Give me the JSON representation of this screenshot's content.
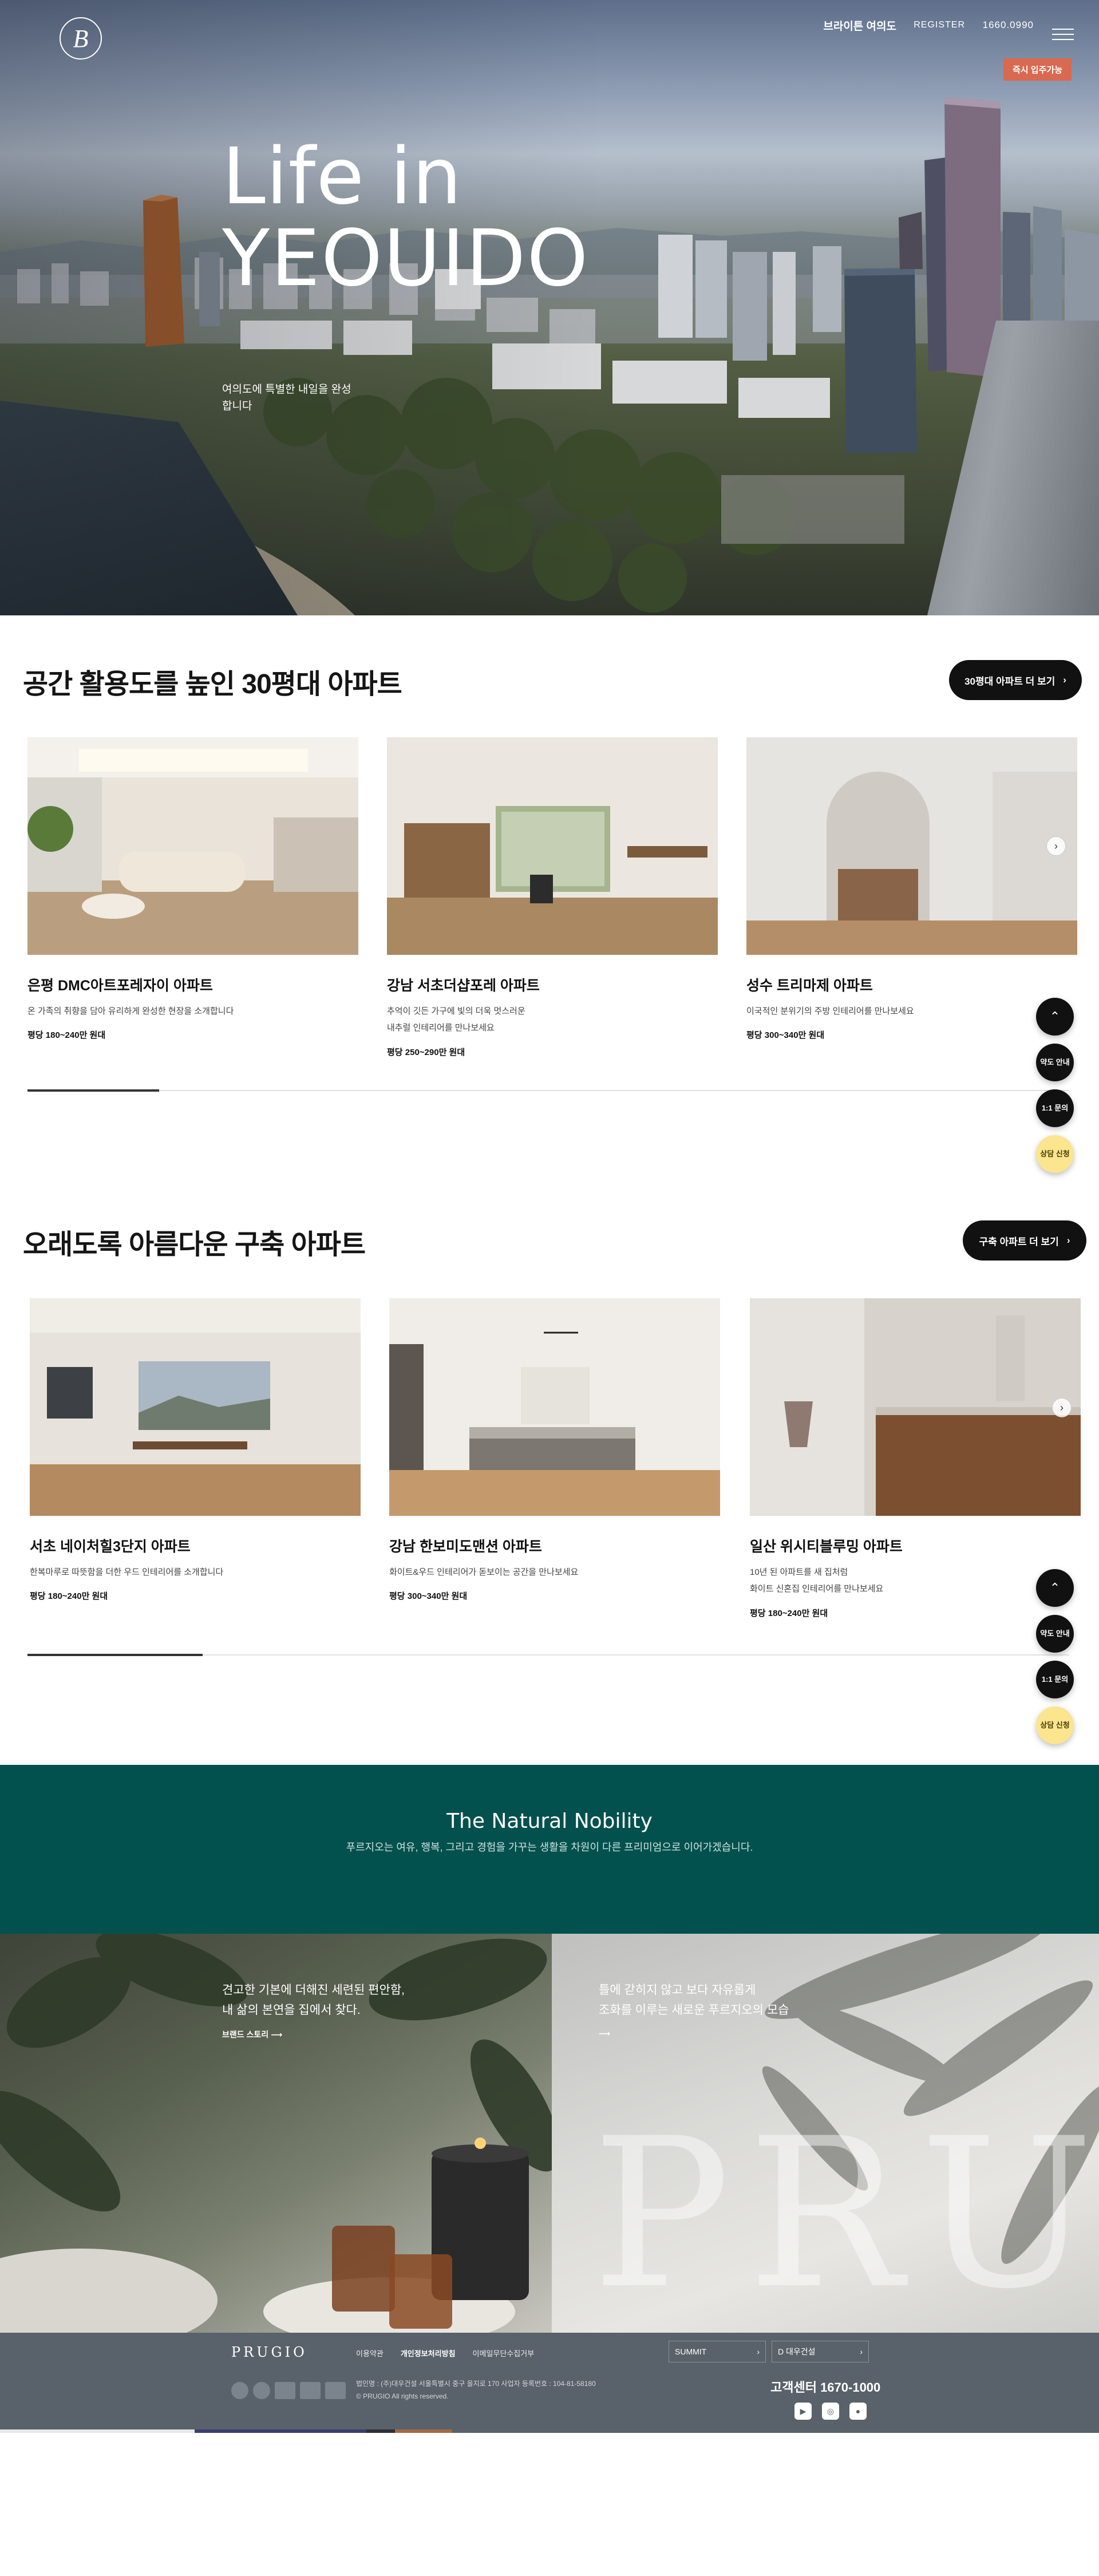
{
  "header": {
    "site_name": "브라이튼 여의도",
    "register": "REGISTER",
    "phone": "1660.0990",
    "move_in_badge": "즉시 입주가능",
    "logo_letter": "B"
  },
  "hero": {
    "title_line1": "Life in",
    "title_line2": "YEOUIDO",
    "subtitle": "여의도에 특별한 내일을 완성합니다"
  },
  "side_buttons": {
    "top": "⌃",
    "directions": "약도 안내",
    "chat": "1:1 문의",
    "consult": "상담 신청"
  },
  "section1": {
    "title": "공간 활용도를 높인 30평대 아파트",
    "more_button": "30평대 아파트 더 보기",
    "cards": [
      {
        "name": "은평 DMC아트포레자이 아파트",
        "desc": "온 가족의 취향을 담아 유리하게 완성한 현장을 소개합니다",
        "price": "평당 180~240만 원대"
      },
      {
        "name": "강남 서초더샵포레 아파트",
        "desc": "추억이 깃든 가구에 빛의 더욱 멋스러운\n내추럴 인테리어를 만나보세요",
        "price": "평당 250~290만 원대"
      },
      {
        "name": "성수 트리마제 아파트",
        "desc": "이국적인 분위기의 주방 인테리어를 만나보세요",
        "price": "평당 300~340만 원대"
      }
    ]
  },
  "section2": {
    "title": "오래도록 아름다운 구축 아파트",
    "more_button": "구축 아파트 더 보기",
    "cards": [
      {
        "name": "서초 네이처힐3단지 아파트",
        "desc": "한복마루로 따뜻함을 더한 우드 인테리어를 소개합니다",
        "price": "평당 180~240만 원대"
      },
      {
        "name": "강남 한보미도맨션 아파트",
        "desc": "화이트&우드 인테리어가 돋보이는 공간을 만나보세요",
        "price": "평당 300~340만 원대"
      },
      {
        "name": "일산 위시티블루밍 아파트",
        "desc": "10년 된 아파트를 새 집처럼\n화이트 신혼집 인테리어를 만나보세요",
        "price": "평당 180~240만 원대"
      }
    ]
  },
  "brand": {
    "title": "The Natural Nobility",
    "subtitle": "푸르지오는 여유, 행복, 그리고 경험을 가꾸는 생활을 차원이 다른 프리미엄으로 이어가겠습니다."
  },
  "lifestyle": {
    "left_text": "견고한 기본에 더해진 세련된 편안함,\n내 삶의 본연을 집에서 찾다.",
    "left_link": "브랜드 스토리",
    "right_text": "틀에 갇히지 않고 보다 자유롭게\n조화를 이루는 새로운 푸르지오의 모습",
    "right_link": "",
    "big_word": "PRU"
  },
  "footer": {
    "brand": "PRUGIO",
    "links": [
      "이용약관",
      "개인정보처리방침",
      "이메일무단수집거부"
    ],
    "family1": "SUMMIT",
    "family2": "D 대우건설",
    "address": "법인명 : (주)대우건설 서울특별시 중구 을지로 170 사업자 등록번호 : 104-81-58180\n© PRUGIO All rights reserved.",
    "cs": "고객센터 1670-1000",
    "sns": [
      "▶",
      "◎",
      "●"
    ]
  },
  "colors": {
    "brand_green": "#03514f",
    "accent_orange": "#d9694f",
    "consult_yellow": "#fbe58f",
    "footer_gray": "#59616a"
  }
}
